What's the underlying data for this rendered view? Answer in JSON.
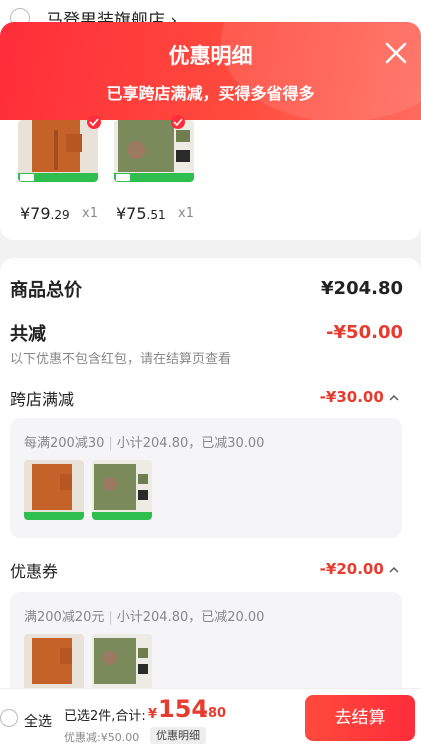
{
  "store": {
    "name": "马登男装旗舰店 ›"
  },
  "banner": {
    "title": "优惠明细",
    "subtitle": "已享跨店满减，买得多省得多"
  },
  "products": [
    {
      "price_int": "¥79",
      "price_dec": ".29",
      "qty": "x1"
    },
    {
      "price_int": "¥75",
      "price_dec": ".51",
      "qty": "x1"
    }
  ],
  "summary": {
    "total_label": "商品总价",
    "total_value": "¥204.80",
    "reduce_label": "共减",
    "reduce_value": "-¥50.00",
    "note": "以下优惠不包含红包，请在结算页查看"
  },
  "promos": [
    {
      "label": "跨店满减",
      "value": "-¥30.00",
      "rule": "每满200减30",
      "detail": "小计204.80，已减30.00"
    },
    {
      "label": "优惠券",
      "value": "-¥20.00",
      "rule": "满200减20元",
      "detail": "小计204.80，已减20.00"
    }
  ],
  "bottom": {
    "select_all": "全选",
    "selected": "已选2件,合计:",
    "total_symbol": "¥",
    "total_int": "154",
    "total_dec": ".80",
    "discount": "优惠减:¥50.00",
    "detail_btn": "优惠明细",
    "checkout": "去结算"
  },
  "colors": {
    "accent": "#ff2d3a",
    "price_red": "#e63b2e",
    "green_tag": "#2fbf4f"
  },
  "icons": {
    "close": "close-icon",
    "chevron": "chevron-up-icon",
    "radio": "radio-circle-icon"
  }
}
